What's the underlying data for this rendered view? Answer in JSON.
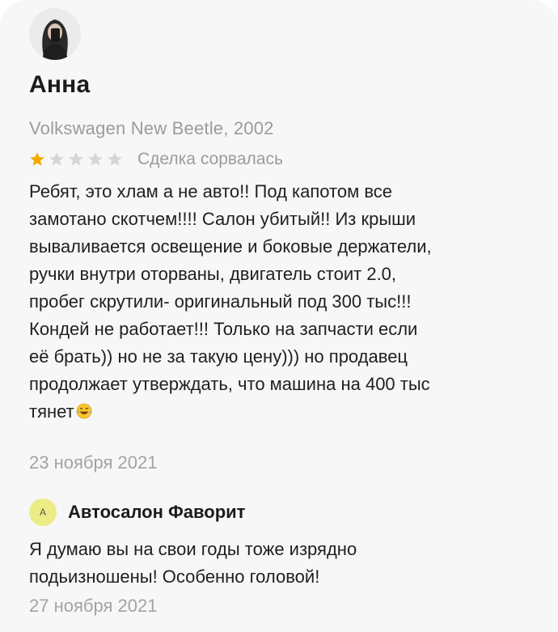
{
  "review": {
    "author_name": "Анна",
    "car": "Volkswagen New Beetle, 2002",
    "rating": 1,
    "rating_max": 5,
    "deal_status": "Сделка сорвалась",
    "text_lines": [
      "Ребят, это хлам а не авто!! Под капотом все",
      "замотано скотчем!!!! Салон убитый!! Из крыши",
      "вываливается освещение и боковые держатели,",
      "ручки внутри оторваны, двигатель стоит 2.0,",
      "пробег скрутили- оригинальный под 300 тыс!!!",
      "Кондей не работает!!! Только на запчасти если",
      "её брать)) но не за такую цену))) но продавец",
      "продолжает утверждать, что машина на 400 тыс",
      "тянет"
    ],
    "emoji_icon": "face-with-tears-of-joy-icon",
    "date": "23 ноября 2021"
  },
  "reply": {
    "avatar_letter": "A",
    "author_name": "Автосалон Фаворит",
    "text_lines": [
      "Я думаю вы на свои годы тоже изрядно",
      "подьизношены! Особенно головой!"
    ],
    "date": "27 ноября 2021"
  },
  "colors": {
    "card_background": "#f7f7f7",
    "star_filled": "#f2a900",
    "star_empty": "#d6d6d6",
    "muted_text": "#9b9b9b",
    "reply_avatar": "#ecec86"
  }
}
